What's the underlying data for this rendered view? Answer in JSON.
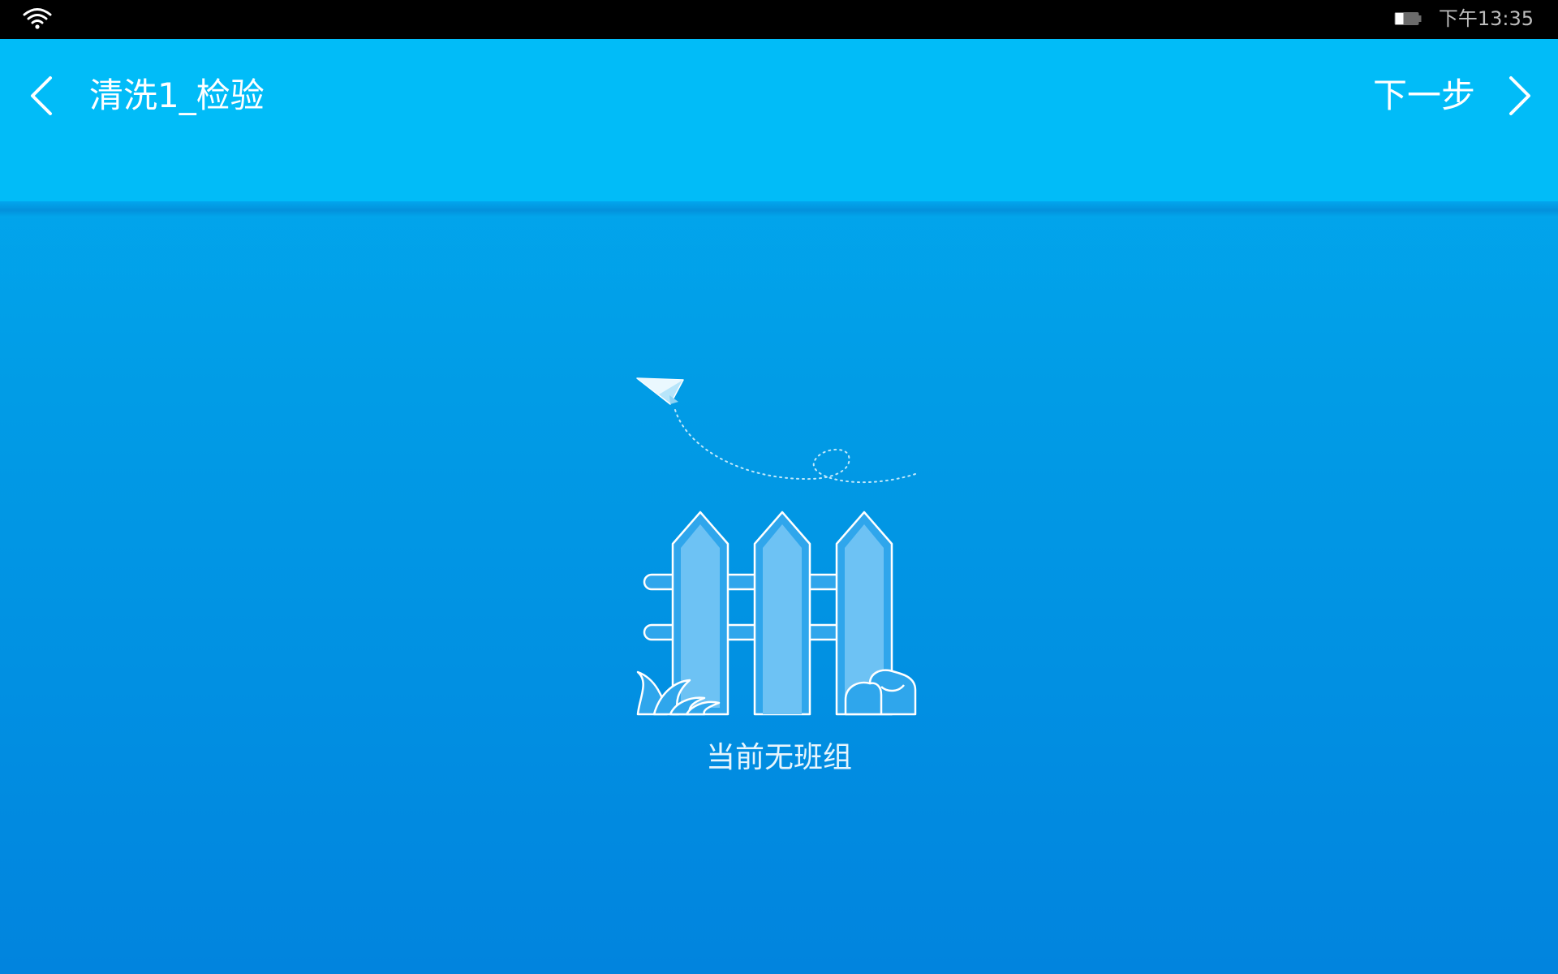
{
  "status_bar": {
    "time": "下午13:35",
    "wifi_icon": "wifi-icon",
    "battery_icon": "battery-icon"
  },
  "app_bar": {
    "back_icon": "chevron-left-icon",
    "title": "清洗1_检验",
    "next_label": "下一步",
    "next_icon": "chevron-right-icon"
  },
  "empty_state": {
    "illustration": "fence-illustration",
    "message": "当前无班组"
  },
  "colors": {
    "app_bar": "#01bcf8",
    "background_top": "#02aef2",
    "background_bottom": "#0184de",
    "status_bar": "#000000"
  }
}
